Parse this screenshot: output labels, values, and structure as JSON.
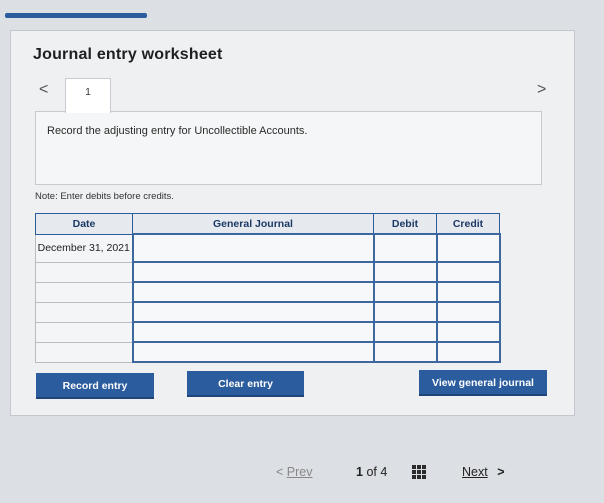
{
  "header": {
    "title": "Journal entry worksheet"
  },
  "tabs": [
    {
      "label": "1"
    }
  ],
  "nav": {
    "prev_arrow": "<",
    "next_arrow": ">"
  },
  "question": {
    "text": "Record the adjusting entry for Uncollectible Accounts."
  },
  "note": "Note: Enter debits before credits.",
  "table": {
    "columns": [
      "Date",
      "General Journal",
      "Debit",
      "Credit"
    ],
    "rows": [
      {
        "date": "December 31, 2021",
        "account": "",
        "debit": "",
        "credit": ""
      },
      {
        "date": "",
        "account": "",
        "debit": "",
        "credit": ""
      },
      {
        "date": "",
        "account": "",
        "debit": "",
        "credit": ""
      },
      {
        "date": "",
        "account": "",
        "debit": "",
        "credit": ""
      },
      {
        "date": "",
        "account": "",
        "debit": "",
        "credit": ""
      },
      {
        "date": "",
        "account": "",
        "debit": "",
        "credit": ""
      }
    ]
  },
  "buttons": {
    "record": "Record entry",
    "clear": "Clear entry",
    "view": "View general journal"
  },
  "pager": {
    "prev": "Prev",
    "current": "1",
    "of_label": "of",
    "total": "4",
    "next": "Next"
  },
  "colors": {
    "accent": "#2b5c9e",
    "background": "#dcdfe4"
  }
}
